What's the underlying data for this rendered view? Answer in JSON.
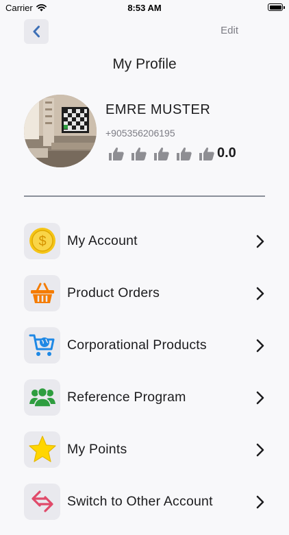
{
  "status_bar": {
    "carrier": "Carrier",
    "time": "8:53 AM"
  },
  "header": {
    "back_icon": "chevron-left-icon",
    "edit_label": "Edit",
    "title": "My Profile"
  },
  "profile": {
    "name": "EMRE MUSTER",
    "phone": "+905356206195",
    "rating_icons": [
      "thumbs-up-icon",
      "thumbs-up-icon",
      "thumbs-up-icon",
      "thumbs-up-icon",
      "thumbs-up-icon"
    ],
    "rating_value": "0.0"
  },
  "menu": {
    "items": [
      {
        "label": "My Account",
        "icon": "coin-dollar-icon"
      },
      {
        "label": "Product Orders",
        "icon": "basket-icon"
      },
      {
        "label": "Corporational Products",
        "icon": "globe-cart-icon"
      },
      {
        "label": "Reference Program",
        "icon": "group-icon"
      },
      {
        "label": "My Points",
        "icon": "star-icon"
      },
      {
        "label": "Switch to Other Account",
        "icon": "switch-arrows-icon"
      }
    ]
  },
  "colors": {
    "background": "#f8f8fa",
    "icon_box": "#e9e9ee",
    "coin": "#f5c518",
    "basket": "#f57c00",
    "globe_cart": "#1e88e5",
    "group": "#2e9d3f",
    "star": "#ffd600",
    "switch": "#e04a6a",
    "thumb": "#8e8e93"
  }
}
